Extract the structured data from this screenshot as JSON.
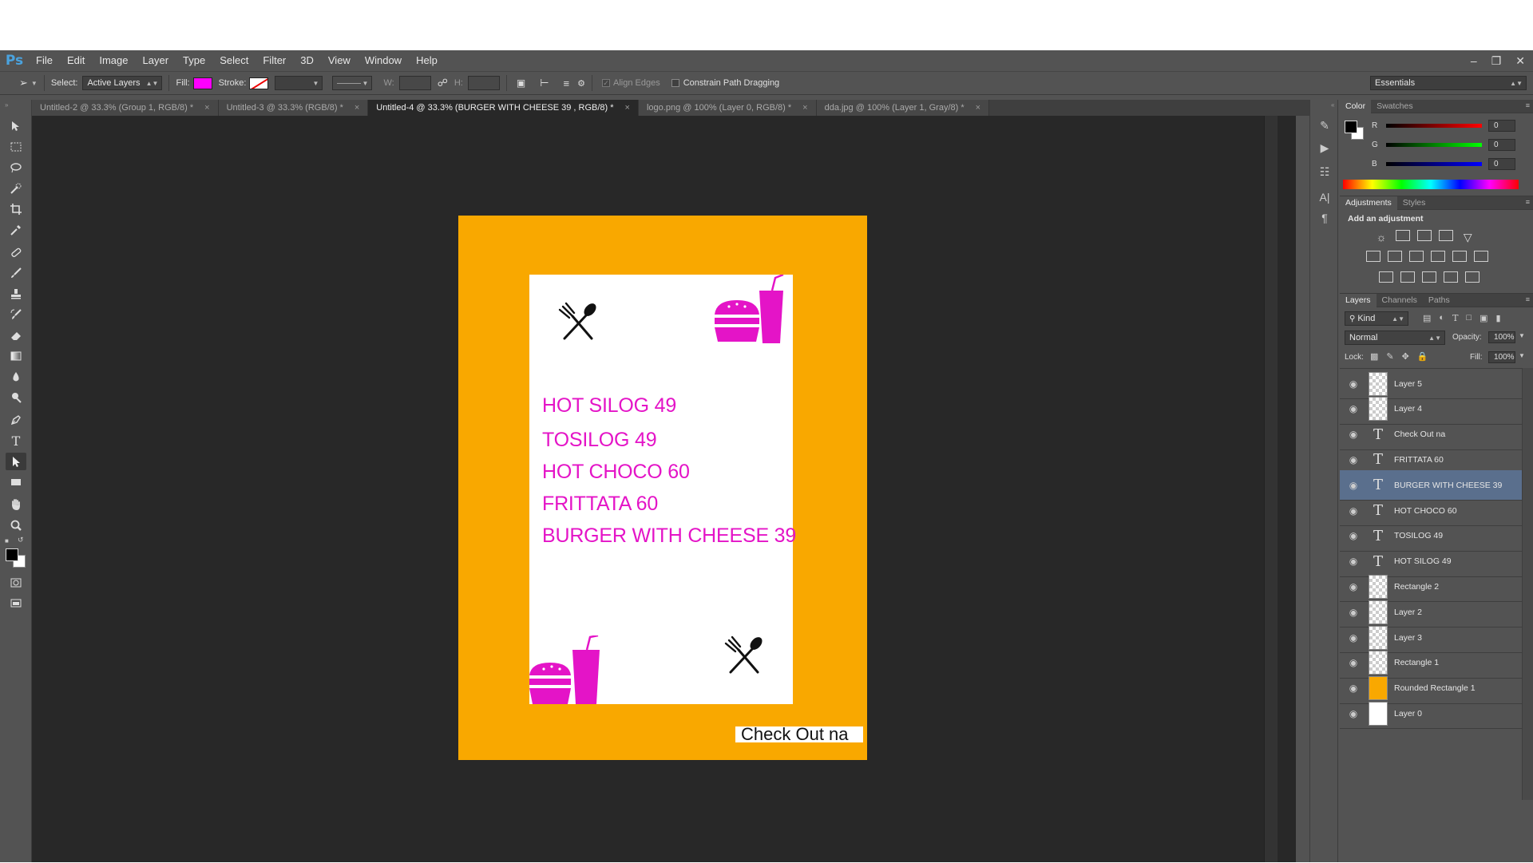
{
  "app": {
    "logo": "Ps"
  },
  "menu": [
    "File",
    "Edit",
    "Image",
    "Layer",
    "Type",
    "Select",
    "Filter",
    "3D",
    "View",
    "Window",
    "Help"
  ],
  "window_controls": [
    "minimize-icon",
    "restore-icon",
    "close-icon"
  ],
  "options": {
    "select_label": "Select:",
    "select_value": "Active Layers",
    "fill_label": "Fill:",
    "fill_color": "#ff00ff",
    "stroke_label": "Stroke:",
    "w_label": "W:",
    "h_label": "H:",
    "align_edges": "Align Edges",
    "constrain": "Constrain Path Dragging",
    "workspace": "Essentials"
  },
  "tabs": [
    {
      "label": "Untitled-2 @ 33.3% (Group 1, RGB/8) *",
      "active": false
    },
    {
      "label": "Untitled-3 @ 33.3% (RGB/8) *",
      "active": false
    },
    {
      "label": "Untitled-4 @ 33.3% (BURGER WITH CHEESE 39 , RGB/8) *",
      "active": true
    },
    {
      "label": "logo.png @ 100% (Layer 0, RGB/8) *",
      "active": false
    },
    {
      "label": "dda.jpg @ 100% (Layer 1, Gray/8) *",
      "active": false
    }
  ],
  "document": {
    "bg_color": "#f9a800",
    "text_color": "#e414c7",
    "menu_items": [
      "HOT SILOG 49",
      "TOSILOG 49",
      "HOT CHOCO 60",
      "FRITTATA 60",
      "BURGER WITH CHEESE 39"
    ],
    "checkout": "Check Out na"
  },
  "color_panel": {
    "tabs": [
      "Color",
      "Swatches"
    ],
    "channels": [
      {
        "label": "R",
        "value": "0"
      },
      {
        "label": "G",
        "value": "0"
      },
      {
        "label": "B",
        "value": "0"
      }
    ]
  },
  "adjustments_panel": {
    "tabs": [
      "Adjustments",
      "Styles"
    ],
    "title": "Add an adjustment"
  },
  "layers_panel": {
    "tabs": [
      "Layers",
      "Channels",
      "Paths"
    ],
    "filter": "Kind",
    "blend_mode": "Normal",
    "opacity_label": "Opacity:",
    "opacity": "100%",
    "lock_label": "Lock:",
    "fill_label": "Fill:",
    "fill": "100%",
    "layers": [
      {
        "name": "Layer 5",
        "kind": "pixel",
        "selected": false
      },
      {
        "name": "Layer 4",
        "kind": "pixel",
        "selected": false
      },
      {
        "name": "Check Out na",
        "kind": "text",
        "selected": false
      },
      {
        "name": "FRITTATA 60",
        "kind": "text",
        "selected": false
      },
      {
        "name": "BURGER WITH CHEESE 39",
        "kind": "text",
        "selected": true
      },
      {
        "name": "HOT CHOCO 60",
        "kind": "text",
        "selected": false
      },
      {
        "name": "TOSILOG 49",
        "kind": "text",
        "selected": false
      },
      {
        "name": "HOT SILOG 49",
        "kind": "text",
        "selected": false
      },
      {
        "name": "Rectangle 2",
        "kind": "shape",
        "selected": false
      },
      {
        "name": "Layer 2",
        "kind": "pixel",
        "selected": false
      },
      {
        "name": "Layer 3",
        "kind": "pixel",
        "selected": false
      },
      {
        "name": "Rectangle 1",
        "kind": "shape",
        "selected": false
      },
      {
        "name": "Rounded Rectangle 1",
        "kind": "shape-orange",
        "selected": false
      },
      {
        "name": "Layer 0",
        "kind": "white",
        "selected": false
      }
    ]
  }
}
